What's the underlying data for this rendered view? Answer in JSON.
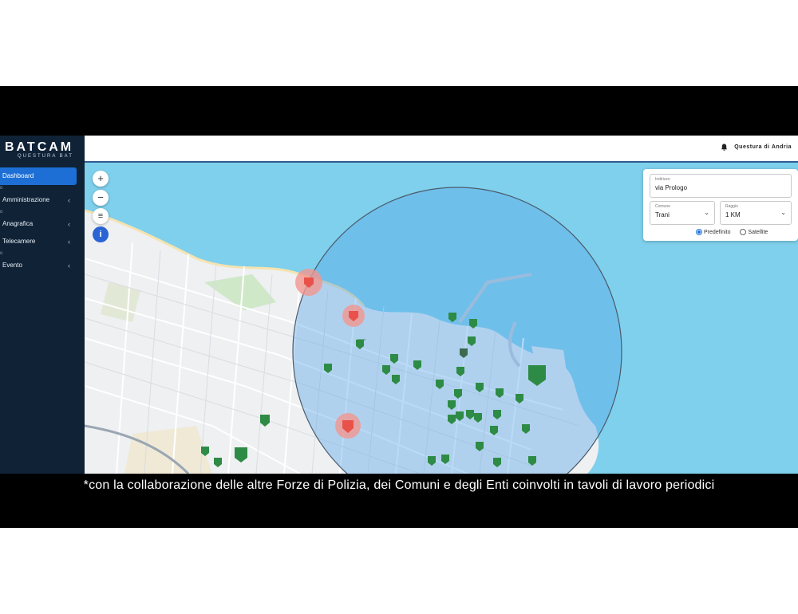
{
  "app": {
    "brand": "BATCAM",
    "brand_sub": "QUESTURA BAT",
    "org_name": "Questura di Andria"
  },
  "sidebar": {
    "items": [
      {
        "label": "Dashboard",
        "active": true,
        "chevron": ""
      },
      {
        "label": "Amministrazione",
        "chevron": "‹"
      },
      {
        "label": "Anagrafica",
        "chevron": "‹"
      },
      {
        "label": "Telecamere",
        "chevron": "‹"
      },
      {
        "label": "Evento",
        "chevron": "‹"
      }
    ]
  },
  "map_controls": {
    "zoom_in": "+",
    "zoom_out": "−",
    "filter": "≡",
    "info": "i"
  },
  "search_panel": {
    "address_label": "Indirizzo",
    "address_value": "via Prologo",
    "comune_label": "Comune",
    "comune_value": "Trani",
    "raggio_label": "Raggio",
    "raggio_value": "1 KM",
    "radio_options": [
      {
        "label": "Predefinito",
        "selected": true
      },
      {
        "label": "Satellite",
        "selected": false
      }
    ]
  },
  "caption": "*con la collaborazione delle altre Forze di Polizia, dei Comuni e degli Enti coinvolti in tavoli di lavoro periodici",
  "colors": {
    "sidebar_bg": "#0f2236",
    "active_blue": "#1d6fd6",
    "sea": "#7fd0ec",
    "radius_fill": "#5aa8ea",
    "camera_green": "#2e8b45",
    "camera_red": "#e8524a"
  }
}
